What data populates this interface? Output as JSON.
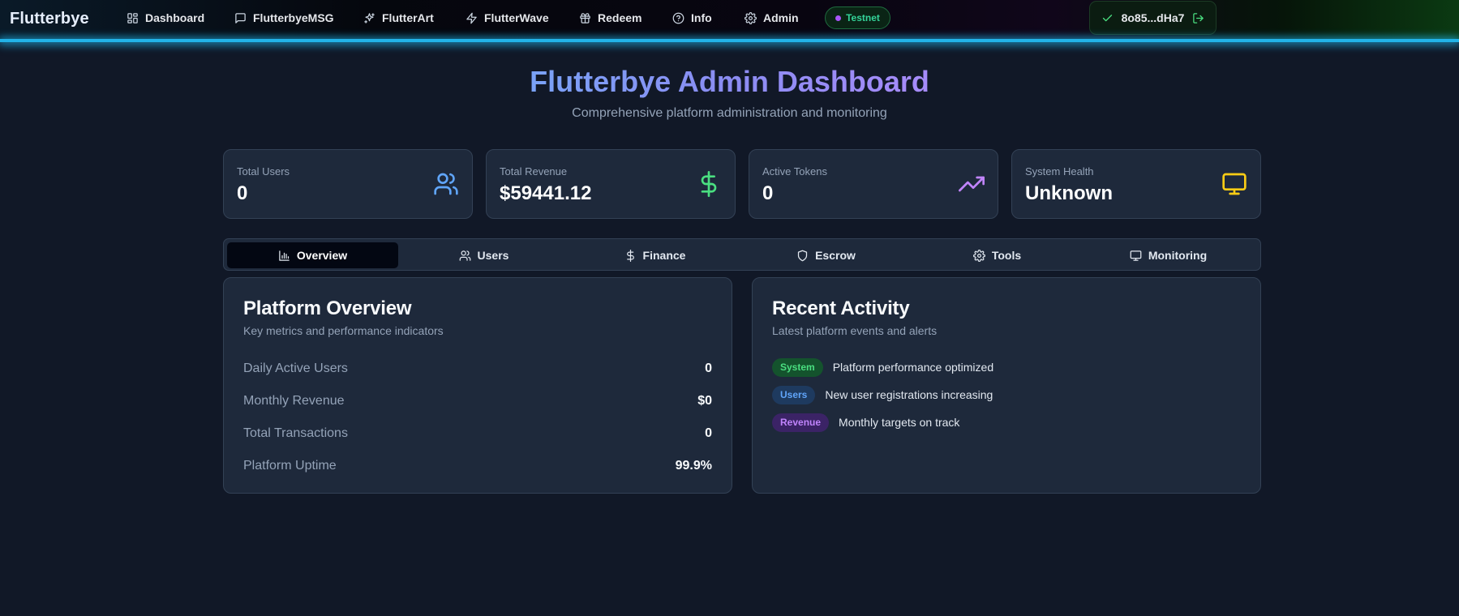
{
  "nav": {
    "brand": "Flutterbye",
    "items": [
      {
        "label": "Dashboard",
        "icon": "grid-icon"
      },
      {
        "label": "FlutterbyeMSG",
        "icon": "message-icon"
      },
      {
        "label": "FlutterArt",
        "icon": "sparkles-icon"
      },
      {
        "label": "FlutterWave",
        "icon": "zap-icon"
      },
      {
        "label": "Redeem",
        "icon": "gift-icon"
      },
      {
        "label": "Info",
        "icon": "help-circle-icon"
      },
      {
        "label": "Admin",
        "icon": "settings-icon"
      }
    ],
    "network_badge": "Testnet",
    "wallet_address": "8o85...dHa7"
  },
  "header": {
    "title": "Flutterbye Admin Dashboard",
    "subtitle": "Comprehensive platform administration and monitoring"
  },
  "stats": [
    {
      "label": "Total Users",
      "value": "0",
      "icon": "users-icon",
      "color": "#60a5fa"
    },
    {
      "label": "Total Revenue",
      "value": "$59441.12",
      "icon": "dollar-icon",
      "color": "#4ade80"
    },
    {
      "label": "Active Tokens",
      "value": "0",
      "icon": "trending-up-icon",
      "color": "#c084fc"
    },
    {
      "label": "System Health",
      "value": "Unknown",
      "icon": "monitor-icon",
      "color": "#facc15"
    }
  ],
  "tabs": [
    {
      "label": "Overview",
      "icon": "bar-chart-icon",
      "active": true
    },
    {
      "label": "Users",
      "icon": "users-icon",
      "active": false
    },
    {
      "label": "Finance",
      "icon": "dollar-icon",
      "active": false
    },
    {
      "label": "Escrow",
      "icon": "shield-icon",
      "active": false
    },
    {
      "label": "Tools",
      "icon": "settings-icon",
      "active": false
    },
    {
      "label": "Monitoring",
      "icon": "monitor-icon",
      "active": false
    }
  ],
  "overview": {
    "title": "Platform Overview",
    "subtitle": "Key metrics and performance indicators",
    "metrics": [
      {
        "label": "Daily Active Users",
        "value": "0"
      },
      {
        "label": "Monthly Revenue",
        "value": "$0"
      },
      {
        "label": "Total Transactions",
        "value": "0"
      },
      {
        "label": "Platform Uptime",
        "value": "99.9%"
      }
    ]
  },
  "activity": {
    "title": "Recent Activity",
    "subtitle": "Latest platform events and alerts",
    "items": [
      {
        "badge": "System",
        "text": "Platform performance optimized",
        "color": "#4ade80",
        "bg": "#14532d"
      },
      {
        "badge": "Users",
        "text": "New user registrations increasing",
        "color": "#60a5fa",
        "bg": "#1e3a5f"
      },
      {
        "badge": "Revenue",
        "text": "Monthly targets on track",
        "color": "#c084fc",
        "bg": "#3b2366"
      }
    ]
  }
}
